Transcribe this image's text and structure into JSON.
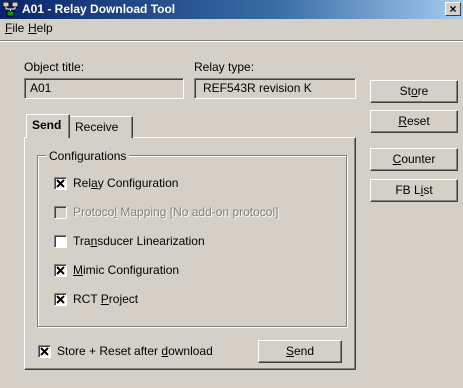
{
  "window": {
    "title": "A01 - Relay Download Tool",
    "close_glyph": "×"
  },
  "menu": [
    {
      "label": "File"
    },
    {
      "label": "Help"
    }
  ],
  "object_title": {
    "label": "Object title:",
    "value": "A01"
  },
  "relay_type": {
    "label": "Relay type:",
    "value": "REF543R revision K"
  },
  "buttons": {
    "store": "Store",
    "reset": "Reset",
    "counter": "Counter",
    "fb_list": "FB List"
  },
  "tabs": [
    {
      "label": "Send",
      "active": true
    },
    {
      "label": "Receive",
      "active": false
    }
  ],
  "configurations": {
    "legend": "Configurations",
    "items": [
      {
        "pre": "Rel",
        "key": "a",
        "post": "y Configuration",
        "checked": true,
        "enabled": true
      },
      {
        "pre": "Protoco",
        "key": "l",
        "post": " Mapping  [No add-on protocol]",
        "checked": false,
        "enabled": false
      },
      {
        "pre": "Tra",
        "key": "n",
        "post": "sducer Linearization",
        "checked": false,
        "enabled": true
      },
      {
        "pre": "",
        "key": "M",
        "post": "imic Configuration",
        "checked": true,
        "enabled": true
      },
      {
        "pre": "RCT ",
        "key": "P",
        "post": "roject",
        "checked": true,
        "enabled": true
      }
    ]
  },
  "store_reset": {
    "pre": "Store + Reset after ",
    "key": "d",
    "post": "ownload",
    "checked": true
  },
  "send_button": "Send"
}
